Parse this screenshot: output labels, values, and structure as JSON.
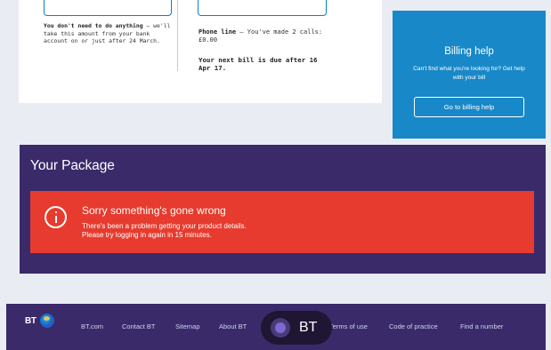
{
  "bill_card": {
    "note_bold": "You don't need to do anything",
    "note_rest": " – we'll take this amount from your bank account on or just after 24 March.",
    "phone_line_label": "Phone line",
    "phone_line_text": " – You've made 2 calls: £0.00",
    "next_bill": "Your next bill is due after 16 Apr 17."
  },
  "billing_help": {
    "title": "Billing help",
    "description": "Can't find what you're looking for? Get help with your bill",
    "cta_label": "Go to billing help"
  },
  "package": {
    "heading": "Your Package",
    "error_title": "Sorry something's gone wrong",
    "error_line1": "There's been a problem getting your product details.",
    "error_line2": "Please try logging in again in 15 minutes."
  },
  "footer": {
    "logo_text": "BT",
    "links": [
      "BT.com",
      "Contact BT",
      "Sitemap",
      "About BT",
      "Terms of use",
      "Code of practice",
      "Find a number"
    ],
    "overlay_badge_text": "BT"
  },
  "colors": {
    "page_bg": "#e9ecf2",
    "billing_blue": "#1888c8",
    "package_purple": "#3a2a6a",
    "error_red": "#e63b2e",
    "outline_blue": "#0b7ec6"
  }
}
